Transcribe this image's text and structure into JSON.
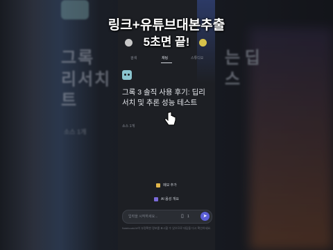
{
  "overlay": {
    "line1": "링크+유튜브대본추출",
    "line2": "5초면 끝!"
  },
  "tabs": [
    {
      "label": "검색"
    },
    {
      "label": "채팅"
    },
    {
      "label": "스튜디오"
    }
  ],
  "note": {
    "title": "그록 3 솔직 사용 후기: 딥리서치 및 추론 성능 테스트",
    "meta": "소스 1개"
  },
  "actions": {
    "note_label": "메모 추가",
    "audio_label": "AI 음성 개요"
  },
  "input": {
    "placeholder": "입력을 시작하세요...",
    "source_count": "1"
  },
  "disclaimer": "NotebookLM이 부정확한 정보를 표시할 수 있으므로 대답을 다시 확인하세요.",
  "background": {
    "left_line1": "그록",
    "left_line2": "리서치",
    "left_line3": "트",
    "left_small": "소스 1개",
    "right_line1": "는 딥",
    "right_line2": "스"
  },
  "colors": {
    "accent": "#5b5fd6",
    "note_icon": "#e2b64a",
    "audio_icon": "#7a6ad8"
  }
}
